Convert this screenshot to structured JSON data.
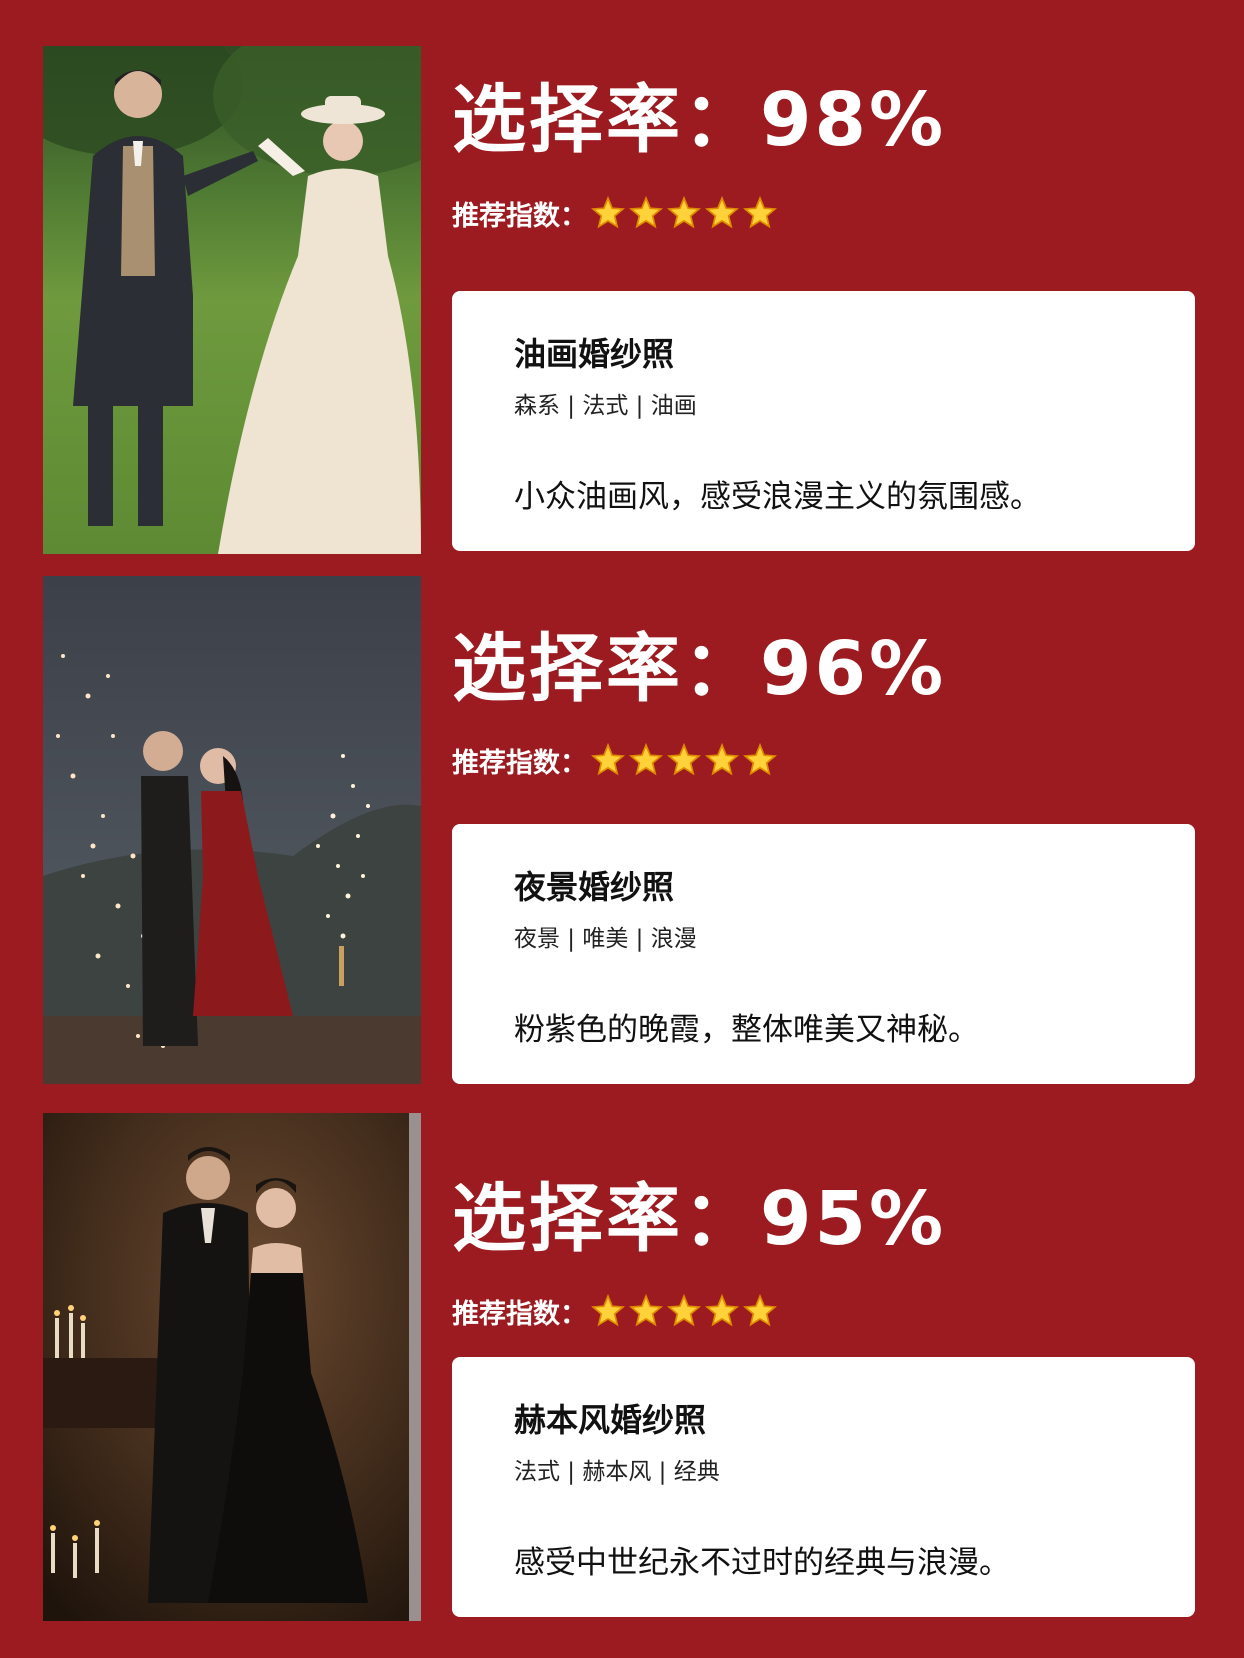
{
  "accent_color": "#9c1b20",
  "items": [
    {
      "rate_text": "选择率：98%",
      "rating_label": "推荐指数：",
      "stars": 5,
      "title": "油画婚纱照",
      "tags": "森系 | 法式 | 油画",
      "description": "小众油画风，感受浪漫主义的氛围感。",
      "photo": "couple-in-garden-photo"
    },
    {
      "rate_text": "选择率：96%",
      "rating_label": "推荐指数：",
      "stars": 5,
      "title": "夜景婚纱照",
      "tags": "夜景 | 唯美 | 浪漫",
      "description": "粉紫色的晚霞，整体唯美又神秘。",
      "photo": "couple-night-sparklers-photo"
    },
    {
      "rate_text": "选择率：95%",
      "rating_label": "推荐指数：",
      "stars": 5,
      "title": "赫本风婚纱照",
      "tags": "法式 | 赫本风 | 经典",
      "description": "感受中世纪永不过时的经典与浪漫。",
      "photo": "couple-candlelight-photo"
    }
  ]
}
